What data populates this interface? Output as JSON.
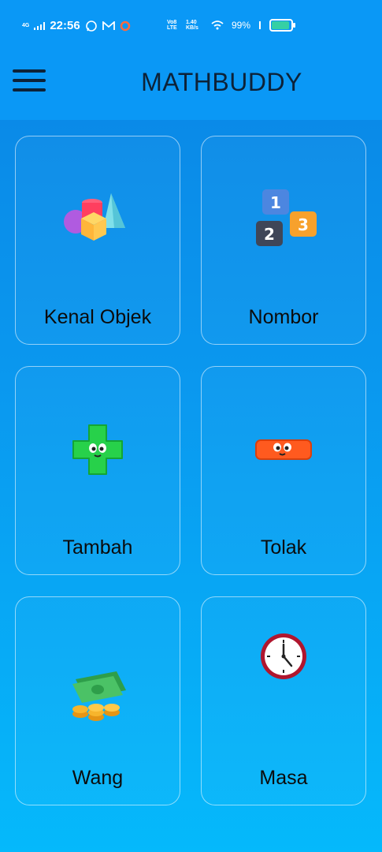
{
  "status_bar": {
    "network": "4G",
    "time": "22:56",
    "volte": "Vo8 LTE",
    "speed": "1.40 KB/s",
    "battery": "99%"
  },
  "app": {
    "title": "MATHBUDDY"
  },
  "menu": [
    {
      "label": "Kenal Objek",
      "icon": "shapes-icon"
    },
    {
      "label": "Nombor",
      "icon": "number-blocks-icon"
    },
    {
      "label": "Tambah",
      "icon": "plus-character-icon"
    },
    {
      "label": "Tolak",
      "icon": "minus-character-icon"
    },
    {
      "label": "Wang",
      "icon": "money-icon"
    },
    {
      "label": "Masa",
      "icon": "clock-icon"
    }
  ],
  "colors": {
    "header": "#0a98f6",
    "title_text": "#0d2238",
    "background_bottom": "#05b9fb"
  }
}
